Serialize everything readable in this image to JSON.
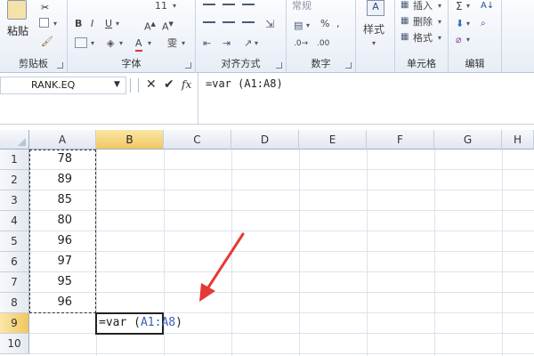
{
  "ribbon": {
    "clipboard": {
      "paste_label": "粘贴",
      "group_label": "剪贴板"
    },
    "font": {
      "size_value": "11",
      "group_label": "字体"
    },
    "alignment": {
      "group_label": "对齐方式"
    },
    "number": {
      "format_value": "常规",
      "percent_symbol": "%",
      "comma_symbol": ",",
      "group_label": "数字"
    },
    "styles": {
      "label": "样式"
    },
    "cells": {
      "insert_label": "插入",
      "delete_label": "删除",
      "format_label": "格式",
      "group_label": "单元格"
    },
    "editing": {
      "group_label": "编辑"
    }
  },
  "formula_bar": {
    "name_box": "RANK.EQ",
    "fx_label": "fx",
    "formula": "=var (A1:A8)"
  },
  "grid": {
    "columns": [
      "A",
      "B",
      "C",
      "D",
      "E",
      "F",
      "G",
      "H"
    ],
    "rows": [
      "1",
      "2",
      "3",
      "4",
      "5",
      "6",
      "7",
      "8",
      "9",
      "10"
    ],
    "column_a_values": [
      "78",
      "89",
      "85",
      "80",
      "96",
      "97",
      "95",
      "96"
    ],
    "active_cell": {
      "address": "B9",
      "prefix": "=var (",
      "range": "A1:A8",
      "suffix": ")"
    }
  },
  "colors": {
    "accent_selection": "#f2c760",
    "range_reference": "#3b5fb8",
    "annotation_arrow": "#e53935"
  }
}
